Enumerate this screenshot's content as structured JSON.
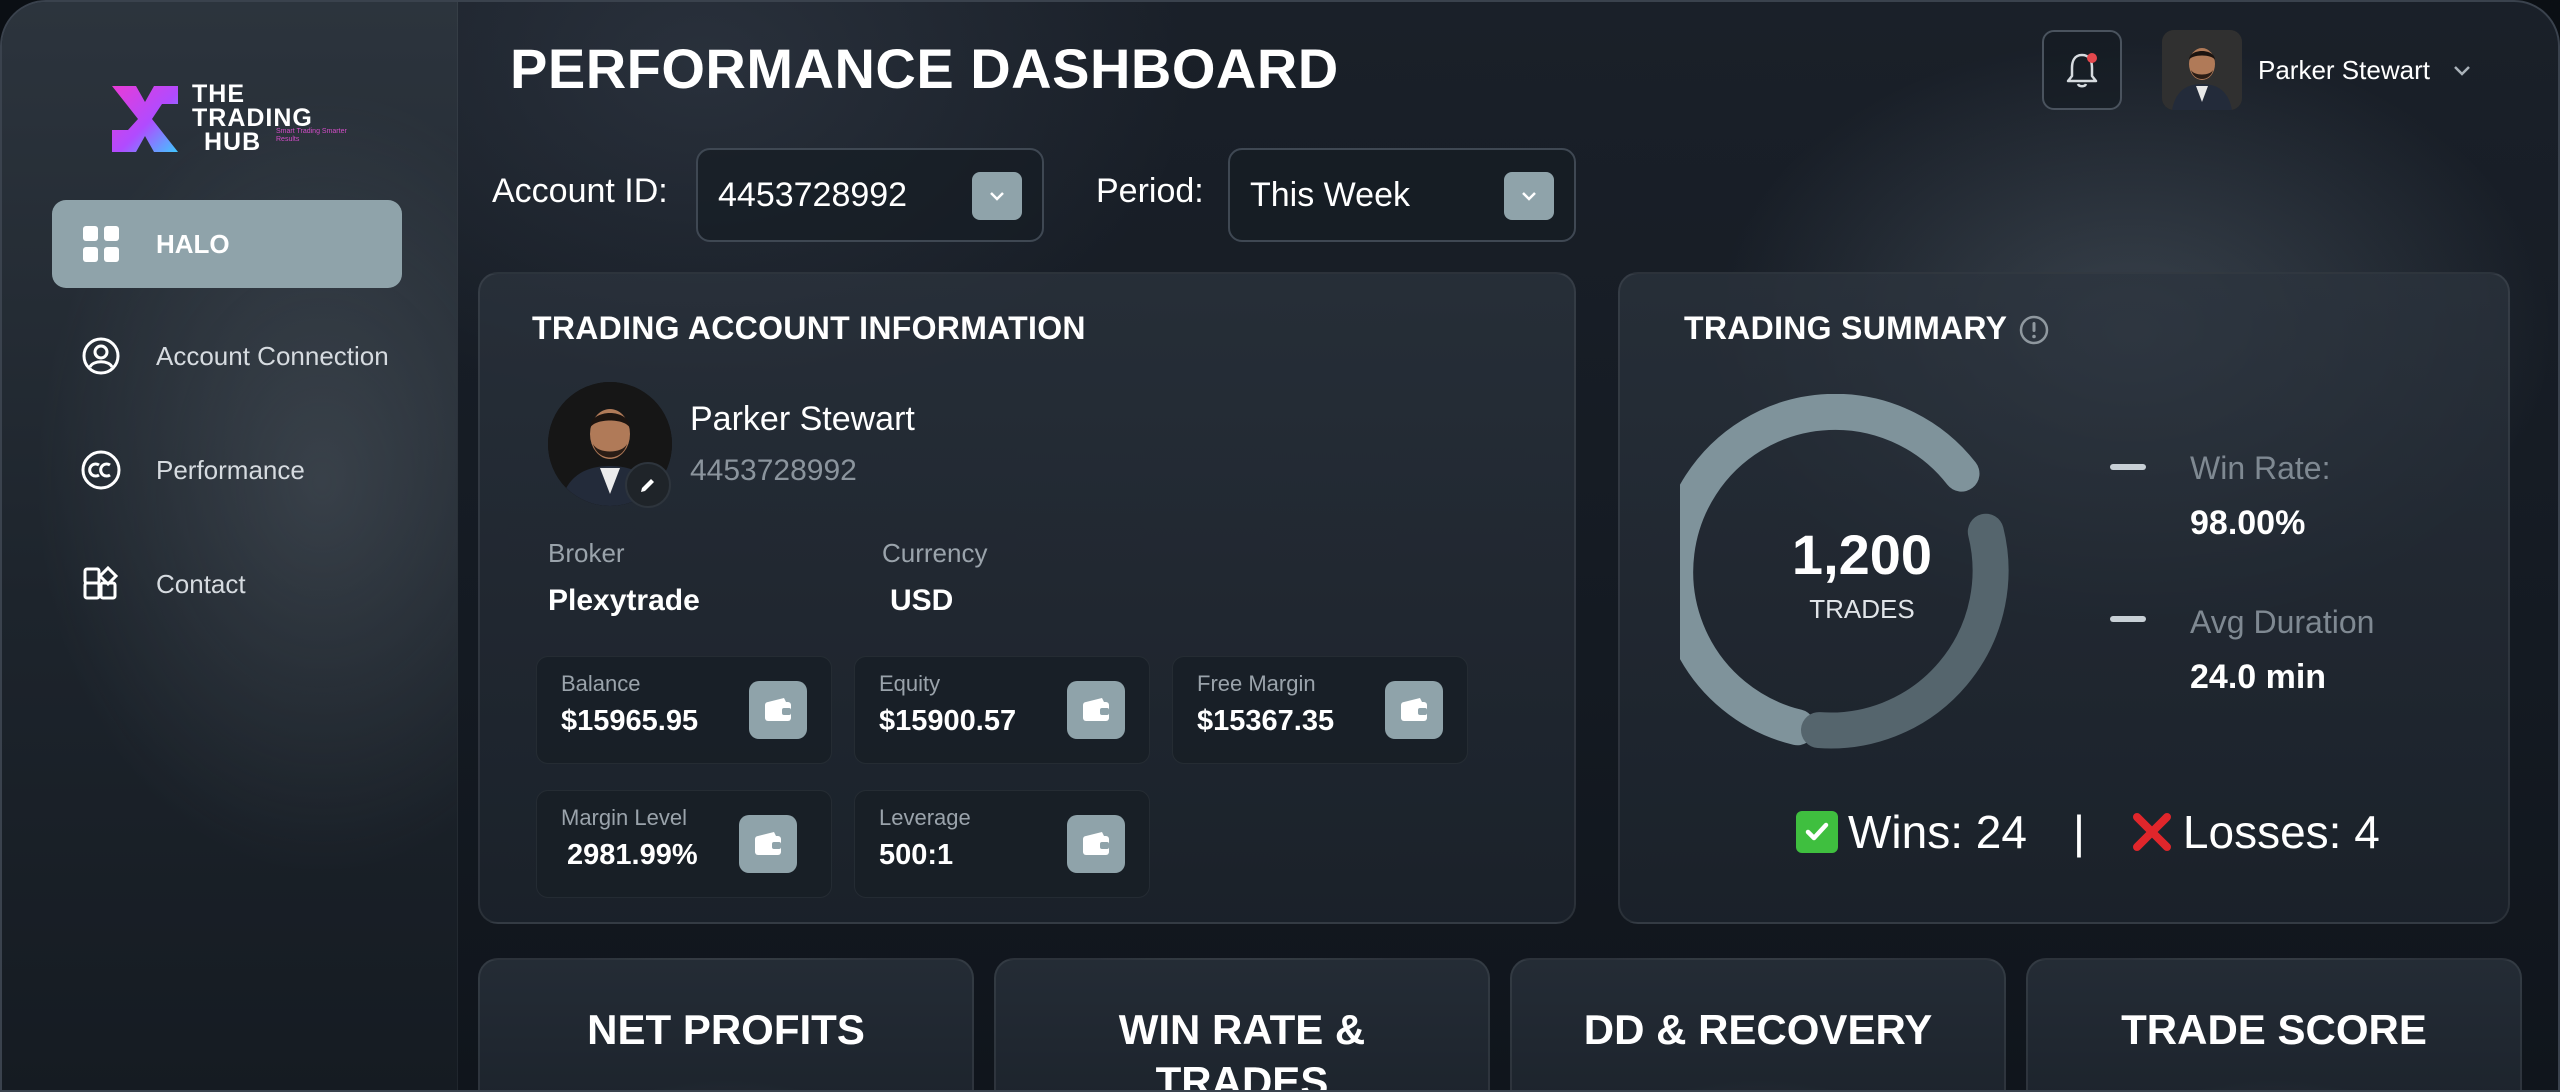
{
  "brand": {
    "logo_lines": [
      "THE",
      "TRADING",
      "HUB"
    ],
    "tagline": "Smart Trading Smarter Results"
  },
  "sidebar": {
    "items": [
      {
        "label": "HALO",
        "icon": "grid-icon",
        "active": true
      },
      {
        "label": "Account Connection",
        "icon": "user-circle-icon",
        "active": false
      },
      {
        "label": "Performance",
        "icon": "cc-circle-icon",
        "active": false
      },
      {
        "label": "Contact",
        "icon": "shapes-icon",
        "active": false
      }
    ]
  },
  "header": {
    "title": "PERFORMANCE DASHBOARD",
    "user_name": "Parker Stewart",
    "notification_dot_color": "#e5484d"
  },
  "filters": {
    "account_label": "Account ID:",
    "account_value": "4453728992",
    "period_label": "Period:",
    "period_value": "This Week"
  },
  "account_info": {
    "title": "TRADING ACCOUNT INFORMATION",
    "name": "Parker Stewart",
    "account_id": "4453728992",
    "broker_label": "Broker",
    "broker_value": "Plexytrade",
    "currency_label": "Currency",
    "currency_value": "USD",
    "tiles": [
      {
        "label": "Balance",
        "value": "$15965.95"
      },
      {
        "label": "Equity",
        "value": "$15900.57"
      },
      {
        "label": "Free Margin",
        "value": "$15367.35"
      },
      {
        "label": "Margin Level",
        "value": "2981.99%"
      },
      {
        "label": "Leverage",
        "value": "500:1"
      }
    ]
  },
  "trading_summary": {
    "title": "TRADING SUMMARY",
    "total_trades": "1,200",
    "trades_label": "TRADES",
    "win_rate_label": "Win Rate:",
    "win_rate_value": "98.00%",
    "avg_duration_label": "Avg Duration",
    "avg_duration_value": "24.0 min",
    "wins_text": "Wins: 24",
    "separator": "|",
    "losses_text": "Losses: 4",
    "ring_color": "#7f939b",
    "win_color": "#3fbf3f",
    "loss_color": "#e0262b"
  },
  "bottom_cards": [
    {
      "title": "NET PROFITS"
    },
    {
      "title": "WIN RATE & TRADES"
    },
    {
      "title": "DD & RECOVERY"
    },
    {
      "title": "TRADE SCORE"
    }
  ],
  "colors": {
    "accent": "#8fa3aa",
    "background": "#141a22"
  }
}
